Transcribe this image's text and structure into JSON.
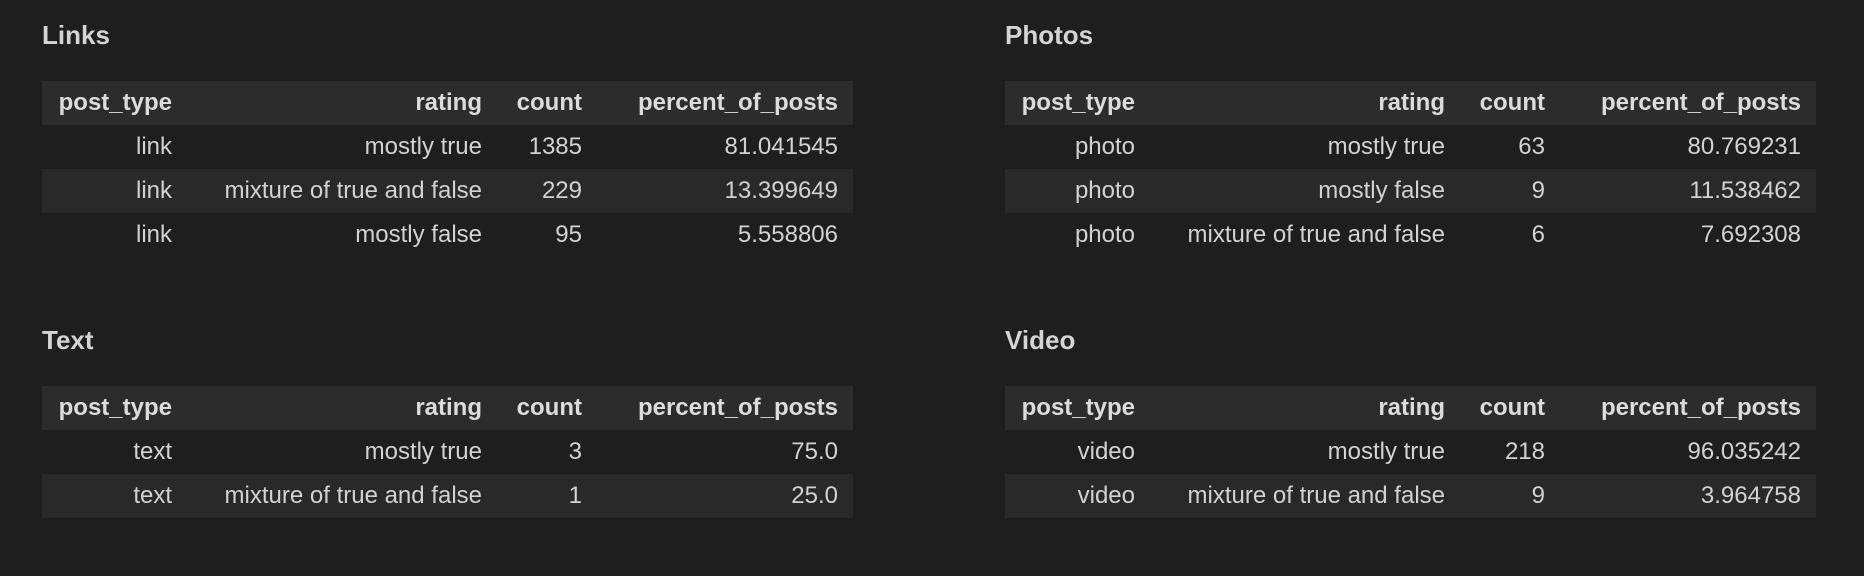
{
  "panels": [
    {
      "title": "Links",
      "columns": [
        "post_type",
        "rating",
        "count",
        "percent_of_posts"
      ],
      "rows": [
        [
          "link",
          "mostly true",
          "1385",
          "81.041545"
        ],
        [
          "link",
          "mixture of true and false",
          "229",
          "13.399649"
        ],
        [
          "link",
          "mostly false",
          "95",
          "5.558806"
        ]
      ]
    },
    {
      "title": "Photos",
      "columns": [
        "post_type",
        "rating",
        "count",
        "percent_of_posts"
      ],
      "rows": [
        [
          "photo",
          "mostly true",
          "63",
          "80.769231"
        ],
        [
          "photo",
          "mostly false",
          "9",
          "11.538462"
        ],
        [
          "photo",
          "mixture of true and false",
          "6",
          "7.692308"
        ]
      ]
    },
    {
      "title": "Text",
      "columns": [
        "post_type",
        "rating",
        "count",
        "percent_of_posts"
      ],
      "rows": [
        [
          "text",
          "mostly true",
          "3",
          "75.0"
        ],
        [
          "text",
          "mixture of true and false",
          "1",
          "25.0"
        ]
      ]
    },
    {
      "title": "Video",
      "columns": [
        "post_type",
        "rating",
        "count",
        "percent_of_posts"
      ],
      "rows": [
        [
          "video",
          "mostly true",
          "218",
          "96.035242"
        ],
        [
          "video",
          "mixture of true and false",
          "9",
          "3.964758"
        ]
      ]
    }
  ]
}
